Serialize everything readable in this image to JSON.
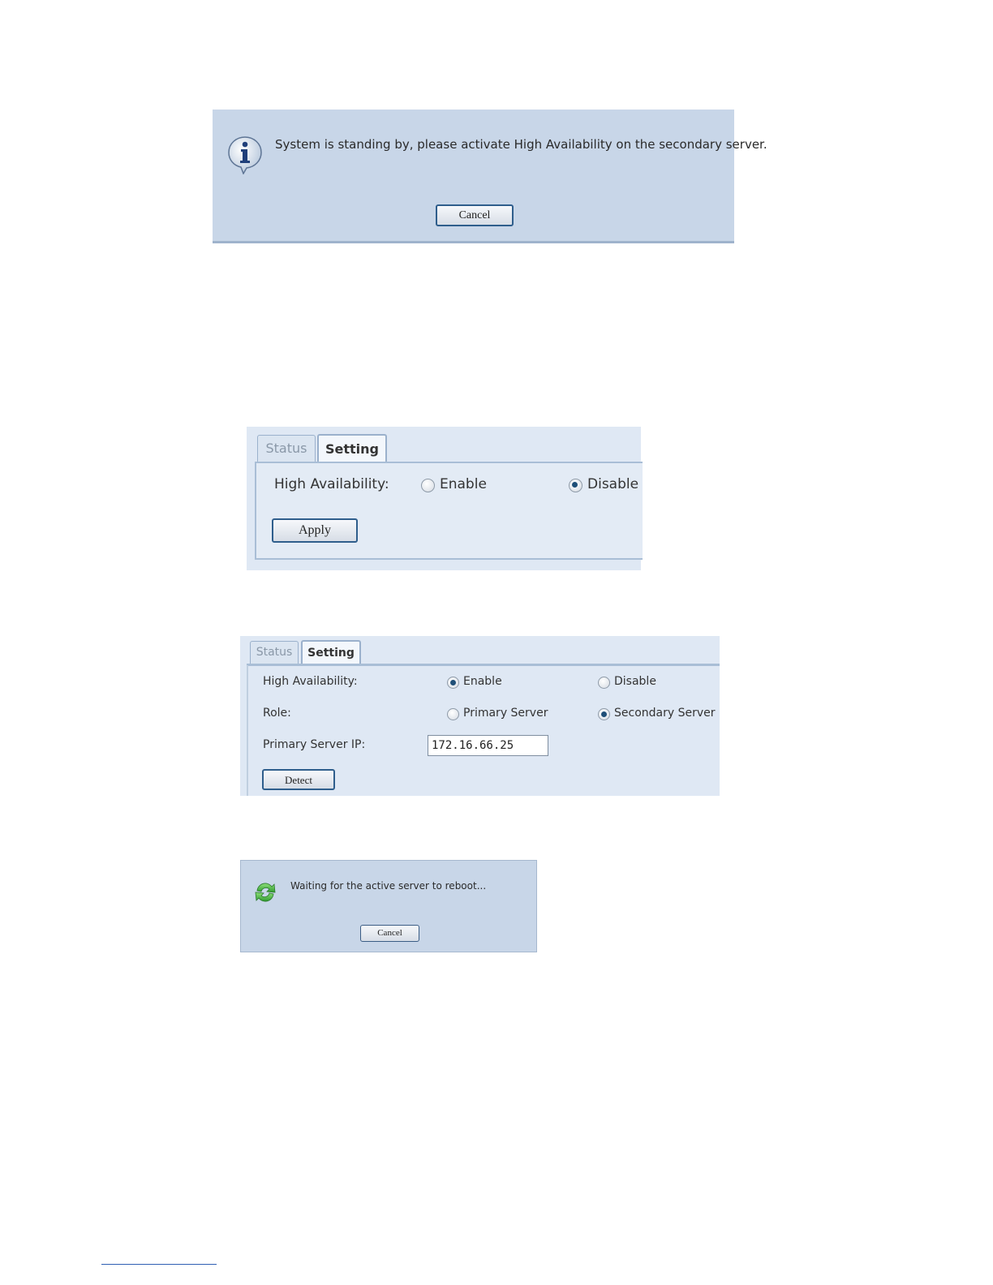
{
  "standby_dialog": {
    "message": "System is standing by, please activate High Availability on the secondary server.",
    "cancel_label": "Cancel"
  },
  "ha_setting_disabled": {
    "tabs": [
      "Status",
      "Setting"
    ],
    "active_tab": "Setting",
    "ha_label": "High Availability:",
    "enable_label": "Enable",
    "disable_label": "Disable",
    "selected": "Disable",
    "apply_label": "Apply"
  },
  "ha_setting_enabled": {
    "tabs": [
      "Status",
      "Setting"
    ],
    "active_tab": "Setting",
    "ha_label": "High Availability:",
    "enable_label": "Enable",
    "disable_label": "Disable",
    "ha_selected": "Enable",
    "role_label": "Role:",
    "primary_label": "Primary Server",
    "secondary_label": "Secondary Server",
    "role_selected": "Secondary Server",
    "primary_ip_label": "Primary Server IP:",
    "primary_ip_value": "172.16.66.25",
    "detect_label": "Detect"
  },
  "reboot_dialog": {
    "message": "Waiting for the active server to reboot...",
    "cancel_label": "Cancel"
  },
  "icons": {
    "info": "info-icon",
    "refresh": "refresh-icon"
  },
  "colors": {
    "dialog_bg": "#c8d6e8",
    "panel_bg": "#dfe8f4",
    "button_border": "#2f5e8c",
    "radio_dot": "#1f4f78"
  }
}
